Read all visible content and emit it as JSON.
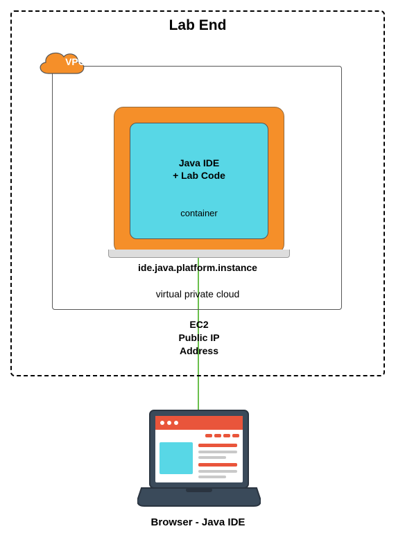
{
  "title": "Lab End",
  "vpc": {
    "badge": "VPC",
    "caption": "virtual private cloud",
    "instance": {
      "label": "ide.java.platform.instance",
      "container": {
        "line1": "Java IDE",
        "line2": "+ Lab Code",
        "sub": "container"
      }
    }
  },
  "ec2": {
    "line1": "EC2",
    "line2": "Public IP",
    "line3": "Address"
  },
  "browser": {
    "label": "Browser - Java IDE"
  }
}
